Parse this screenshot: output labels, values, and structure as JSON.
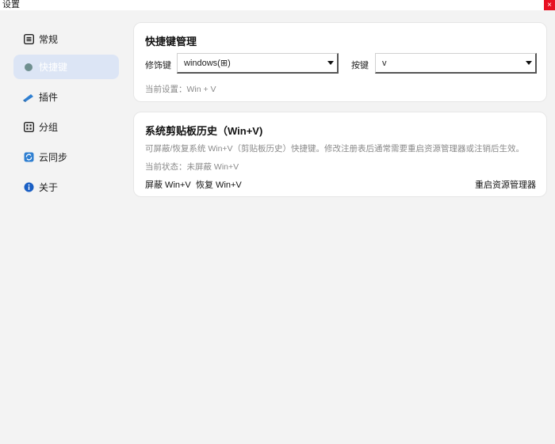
{
  "window": {
    "title": "设置",
    "close_glyph": "×"
  },
  "sidebar": {
    "items": [
      {
        "label": "常规",
        "icon": "list-icon"
      },
      {
        "label": "快捷键",
        "icon": "dot-icon",
        "active": true
      },
      {
        "label": "插件",
        "icon": "plugin-icon"
      },
      {
        "label": "分组",
        "icon": "grid-icon"
      },
      {
        "label": "云同步",
        "icon": "sync-icon"
      },
      {
        "label": "关于",
        "icon": "info-icon"
      }
    ]
  },
  "shortcut_card": {
    "title": "快捷键管理",
    "modifier_label": "修饰键",
    "modifier_value": "windows(⊞)",
    "key_label": "按键",
    "key_value": "v",
    "current_setting": "当前设置：Win + V"
  },
  "clipboard_card": {
    "title": "系统剪贴板历史（Win+V)",
    "description": "可屏蔽/恢复系统 Win+V（剪贴板历史）快捷键。修改注册表后通常需要重启资源管理器或注销后生效。",
    "status": "当前状态：未屏蔽 Win+V",
    "block_label": "屏蔽 Win+V",
    "restore_label": "恢复 Win+V",
    "restart_label": "重启资源管理器"
  },
  "colors": {
    "accent": "#1a73e8",
    "active_bg": "#dce5f5",
    "close": "#e81123"
  }
}
